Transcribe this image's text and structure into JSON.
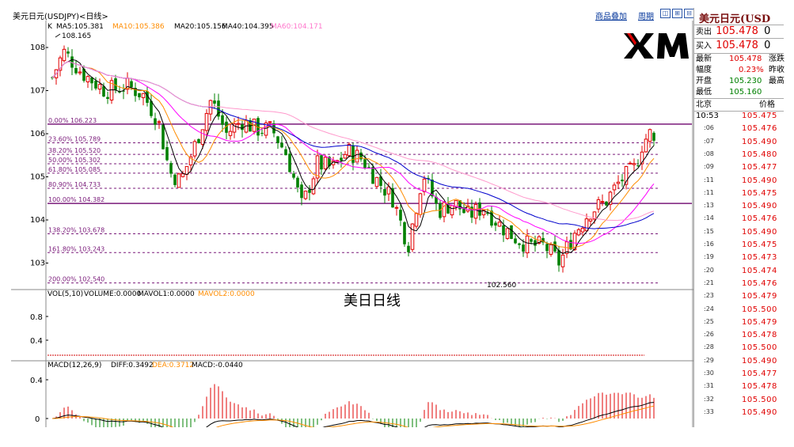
{
  "title": "美元日元(USDJPY)<日线>",
  "top_links": [
    "商品叠加",
    "周期"
  ],
  "window_buttons": [
    "◫",
    "⊞",
    "⊟"
  ],
  "legend": {
    "k": "K",
    "ma5": "MA5:105.381",
    "ma10": "MA10:105.386",
    "ma20": "MA20:105.156",
    "ma40": "MA40:104.395",
    "ma60": "MA60:104.171",
    "high_label": "108.165",
    "low_label": "102.560",
    "colors": {
      "ma5": "#000000",
      "ma10": "#ff8c00",
      "ma20": "#ff00ff",
      "ma40": "#0000cc",
      "ma60": "#ff99cc"
    }
  },
  "yaxis_main": [
    "108",
    "107",
    "106",
    "105",
    "104",
    "103"
  ],
  "fib_levels": [
    {
      "label": "0.00% 106.223",
      "value": 106.223,
      "style": "solid"
    },
    {
      "label": "23.60% 105.789",
      "value": 105.789,
      "style": "dash"
    },
    {
      "label": "38.20% 105.520",
      "value": 105.52,
      "style": "dash"
    },
    {
      "label": "50.00% 105.302",
      "value": 105.302,
      "style": "dash"
    },
    {
      "label": "61.80% 105.085",
      "value": 105.085,
      "style": "dash"
    },
    {
      "label": "80.90% 104.733",
      "value": 104.733,
      "style": "dash"
    },
    {
      "label": "100.00% 104.382",
      "value": 104.382,
      "style": "solid"
    },
    {
      "label": "138.20% 103.678",
      "value": 103.678,
      "style": "dash"
    },
    {
      "label": "161.80% 103.243",
      "value": 103.243,
      "style": "dash"
    },
    {
      "label": "200.00% 102.540",
      "value": 102.54,
      "style": "dash"
    }
  ],
  "watermark": "美日日线",
  "logo": "XM",
  "volume": {
    "legend": "VOL(5,10)",
    "volume": "VOLUME:0.0000",
    "mavol1": "MAVOL1:0.0000",
    "mavol2": "MAVOL2:0.0000",
    "yaxis": [
      "0.8",
      "0.4"
    ]
  },
  "macd": {
    "legend": "MACD(12,26,9)",
    "diff": "DIFF:0.3492",
    "dea": "DEA:0.3712",
    "macd": "MACD:-0.0440",
    "yaxis": [
      "0.4",
      "0"
    ]
  },
  "panel": {
    "symbol": "美元日元(USD",
    "sell_label": "卖出",
    "sell_price": "105.478",
    "sell_qty": "0",
    "buy_label": "买入",
    "buy_price": "105.478",
    "buy_qty": "0",
    "stats": [
      {
        "l": "最新",
        "v": "105.478",
        "r": "涨跌"
      },
      {
        "l": "幅度",
        "v": "0.23%",
        "r": "昨收"
      },
      {
        "l": "开盘",
        "v": "105.230",
        "r": "最高"
      },
      {
        "l": "最低",
        "v": "105.160",
        "r": ""
      }
    ],
    "col_left": "北京",
    "col_right": "价格",
    "ticks": [
      {
        "t": "10:53",
        "p": "105.475"
      },
      {
        "t": ":06",
        "p": "105.476"
      },
      {
        "t": ":07",
        "p": "105.490"
      },
      {
        "t": ":08",
        "p": "105.480"
      },
      {
        "t": ":09",
        "p": "105.477"
      },
      {
        "t": ":11",
        "p": "105.490"
      },
      {
        "t": ":11",
        "p": "105.475"
      },
      {
        "t": ":13",
        "p": "105.490"
      },
      {
        "t": ":14",
        "p": "105.476"
      },
      {
        "t": ":15",
        "p": "105.490"
      },
      {
        "t": ":16",
        "p": "105.475"
      },
      {
        "t": ":19",
        "p": "105.473"
      },
      {
        "t": ":20",
        "p": "105.474"
      },
      {
        "t": ":21",
        "p": "105.476"
      },
      {
        "t": ":23",
        "p": "105.479"
      },
      {
        "t": ":24",
        "p": "105.500"
      },
      {
        "t": ":25",
        "p": "105.479"
      },
      {
        "t": ":26",
        "p": "105.478"
      },
      {
        "t": ":28",
        "p": "105.500"
      },
      {
        "t": ":29",
        "p": "105.490"
      },
      {
        "t": ":30",
        "p": "105.477"
      },
      {
        "t": ":31",
        "p": "105.478"
      },
      {
        "t": ":32",
        "p": "105.500"
      },
      {
        "t": ":33",
        "p": "105.490"
      }
    ]
  }
}
